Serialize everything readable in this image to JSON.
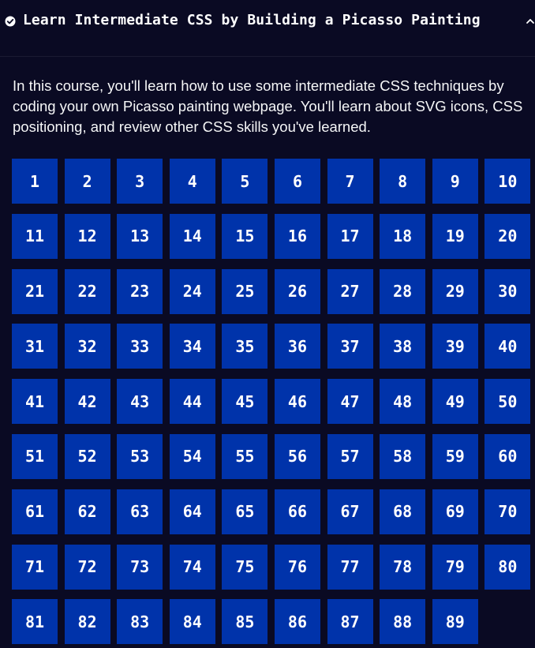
{
  "course": {
    "title": "Learn Intermediate CSS by Building a Picasso Painting",
    "description": "In this course, you'll learn how to use some intermediate CSS techniques by coding your own Picasso painting webpage. You'll learn about SVG icons, CSS positioning, and review other CSS skills you've learned.",
    "completed_icon": "check-circle-icon",
    "toggle_icon": "chevron-up-icon"
  },
  "colors": {
    "background": "#0a0a23",
    "step_background": "#0033aa",
    "text": "#ffffff"
  },
  "steps": [
    "1",
    "2",
    "3",
    "4",
    "5",
    "6",
    "7",
    "8",
    "9",
    "10",
    "11",
    "12",
    "13",
    "14",
    "15",
    "16",
    "17",
    "18",
    "19",
    "20",
    "21",
    "22",
    "23",
    "24",
    "25",
    "26",
    "27",
    "28",
    "29",
    "30",
    "31",
    "32",
    "33",
    "34",
    "35",
    "36",
    "37",
    "38",
    "39",
    "40",
    "41",
    "42",
    "43",
    "44",
    "45",
    "46",
    "47",
    "48",
    "49",
    "50",
    "51",
    "52",
    "53",
    "54",
    "55",
    "56",
    "57",
    "58",
    "59",
    "60",
    "61",
    "62",
    "63",
    "64",
    "65",
    "66",
    "67",
    "68",
    "69",
    "70",
    "71",
    "72",
    "73",
    "74",
    "75",
    "76",
    "77",
    "78",
    "79",
    "80",
    "81",
    "82",
    "83",
    "84",
    "85",
    "86",
    "87",
    "88",
    "89"
  ]
}
